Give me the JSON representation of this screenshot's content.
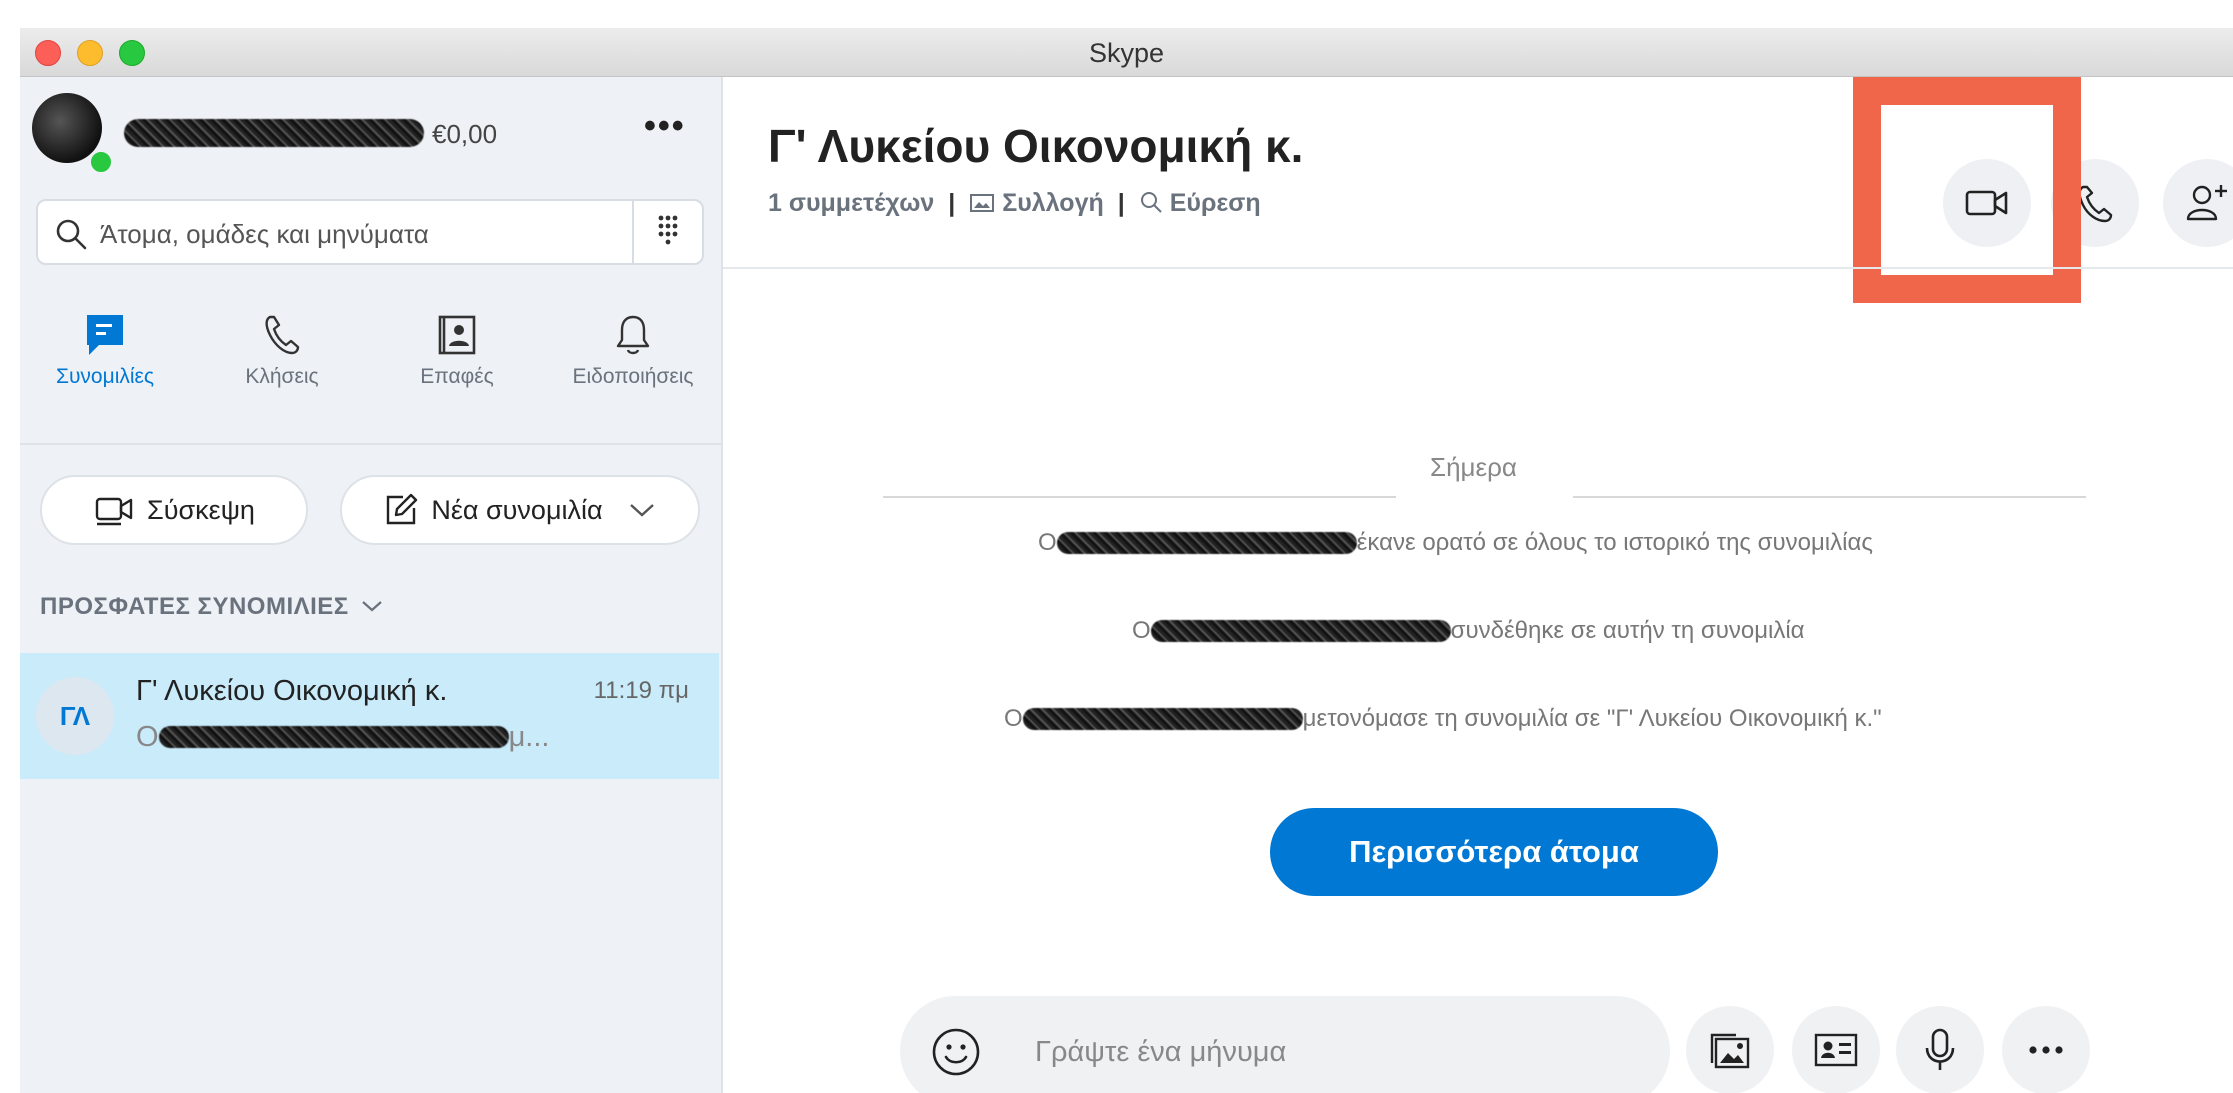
{
  "window": {
    "title": "Skype"
  },
  "profile": {
    "balance": "€0,00",
    "more_label": "•••"
  },
  "search": {
    "placeholder": "Άτομα, ομάδες και μηνύματα"
  },
  "nav": {
    "items": [
      {
        "label": "Συνομιλίες",
        "icon": "chat-icon",
        "active": true
      },
      {
        "label": "Κλήσεις",
        "icon": "phone-icon",
        "active": false
      },
      {
        "label": "Επαφές",
        "icon": "contacts-icon",
        "active": false
      },
      {
        "label": "Ειδοποιήσεις",
        "icon": "bell-icon",
        "active": false
      }
    ]
  },
  "actions": {
    "meet_label": "Σύσκεψη",
    "new_chat_label": "Νέα συνομιλία"
  },
  "recents": {
    "header": "ΠΡΟΣΦΑΤΕΣ ΣΥΝΟΜΙΛΙΕΣ",
    "chats": [
      {
        "initials": "ΓΛ",
        "name": "Γ' Λυκείου Οικονομική κ.",
        "time": "11:19 πμ",
        "preview_start": "Ο",
        "preview_end": "μ..."
      }
    ]
  },
  "conversation": {
    "title": "Γ' Λυκείου Οικονομική κ.",
    "participants": "1 συμμετέχων",
    "gallery_label": "Συλλογή",
    "find_label": "Εύρεση",
    "separator": "|",
    "date_label": "Σήμερα",
    "system_messages": [
      {
        "prefix": "Ο",
        "text": "έκανε ορατό σε όλους το ιστορικό της συνομιλίας"
      },
      {
        "prefix": "Ο",
        "text": "συνδέθηκε σε αυτήν τη συνομιλία"
      },
      {
        "prefix": "Ο",
        "text": "μετονόμασε τη συνομιλία σε \"Γ' Λυκείου Οικονομική κ.\""
      }
    ],
    "more_people_label": "Περισσότερα άτομα",
    "composer_placeholder": "Γράψτε ένα μήνυμα"
  },
  "colors": {
    "accent": "#0078d4",
    "highlight": "#f0664a",
    "selected_row": "#c9ebfa"
  }
}
